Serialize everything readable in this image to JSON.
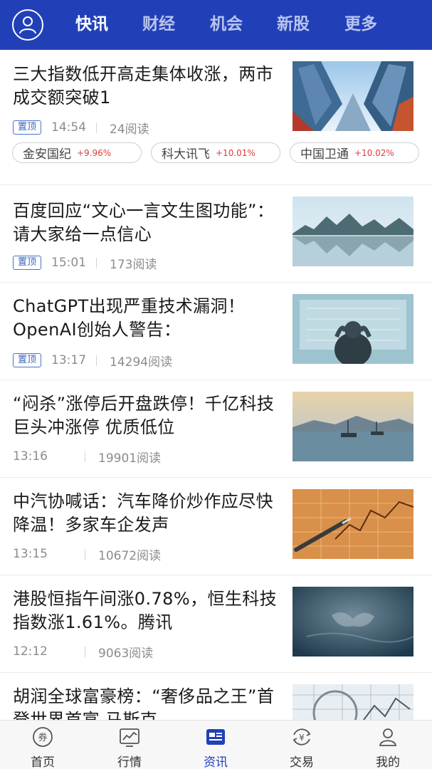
{
  "header": {
    "tabs": [
      {
        "label": "快讯",
        "active": true
      },
      {
        "label": "财经",
        "active": false
      },
      {
        "label": "机会",
        "active": false
      },
      {
        "label": "新股",
        "active": false
      },
      {
        "label": "更多",
        "active": false
      }
    ],
    "avatar_icon": "user-icon"
  },
  "colors": {
    "brand": "#2140b8",
    "up": "#e03b3b",
    "pin": "#3a63bb"
  },
  "feed": {
    "items": [
      {
        "title": "三大指数低开高走集体收涨，两市成交额突破1",
        "pinned_label": "置顶",
        "time": "14:54",
        "reads": "24阅读",
        "stocks": [
          {
            "name": "金安国纪",
            "change": "+9.96%"
          },
          {
            "name": "科大讯飞",
            "change": "+10.01%"
          },
          {
            "name": "中国卫通",
            "change": "+10.02%"
          }
        ],
        "thumb": "skyscrapers-image"
      },
      {
        "title": "百度回应“文心一言文生图功能”：请大家给一点信心",
        "pinned_label": "置顶",
        "time": "15:01",
        "reads": "173阅读",
        "thumb": "lake-mountains-image"
      },
      {
        "title": "ChatGPT出现严重技术漏洞！OpenAI创始人警告：",
        "pinned_label": "置顶",
        "time": "13:17",
        "reads": "14294阅读",
        "thumb": "man-screen-image"
      },
      {
        "title": "“闷杀”涨停后开盘跌停！千亿科技巨头冲涨停 优质低位",
        "time": "13:16",
        "reads": "19901阅读",
        "thumb": "sea-boats-image"
      },
      {
        "title": "中汽协喊话：汽车降价炒作应尽快降温！多家车企发声",
        "time": "13:15",
        "reads": "10672阅读",
        "thumb": "pen-chart-image"
      },
      {
        "title": "港股恒指午间涨0.78%，恒生科技指数涨1.61%。腾讯",
        "time": "12:12",
        "reads": "9063阅读",
        "thumb": "water-texture-image"
      },
      {
        "title": "胡润全球富豪榜：“奢侈品之王”首登世界首富 马斯克",
        "time": "",
        "reads": "",
        "thumb": "magnifier-chart-image"
      }
    ]
  },
  "bottom_nav": {
    "items": [
      {
        "label": "首页",
        "icon": "coupon-icon",
        "active": false
      },
      {
        "label": "行情",
        "icon": "chart-icon",
        "active": false
      },
      {
        "label": "资讯",
        "icon": "news-icon",
        "active": true
      },
      {
        "label": "交易",
        "icon": "yen-exchange-icon",
        "active": false
      },
      {
        "label": "我的",
        "icon": "user-icon",
        "active": false
      }
    ]
  }
}
